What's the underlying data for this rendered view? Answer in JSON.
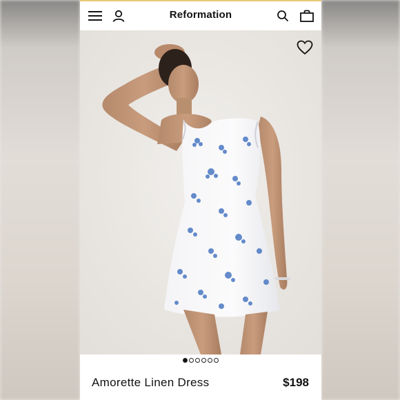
{
  "header": {
    "title": "Reformation",
    "menu_icon": "hamburger-menu-icon",
    "account_icon": "user-icon",
    "search_icon": "search-icon",
    "bag_icon": "shopping-bag-icon"
  },
  "hero": {
    "favorite_icon": "heart-icon",
    "image_alt": "model wearing white dress with blue floral print"
  },
  "carousel": {
    "total": 6,
    "active_index": 0
  },
  "product": {
    "name": "Amorette Linen Dress",
    "price": "$198"
  },
  "colors": {
    "accent_line": "#e8c977",
    "floral_blue": "#4a78c2"
  }
}
